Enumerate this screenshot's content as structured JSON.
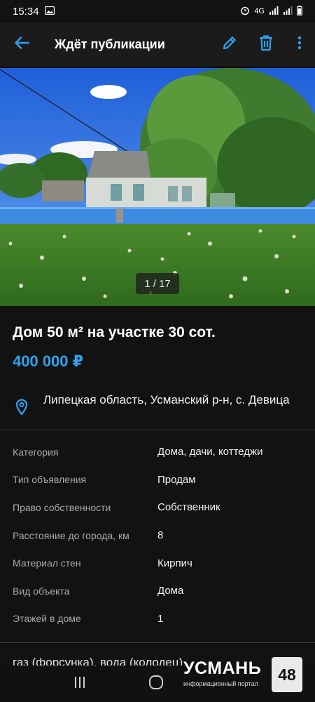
{
  "status_bar": {
    "time": "15:34",
    "network_label": "4G"
  },
  "app_bar": {
    "title": "Ждёт публикации"
  },
  "listing": {
    "photo_counter": "1 / 17",
    "title": "Дом 50 м² на участке 30 сот.",
    "price": "400 000 ₽",
    "location": "Липецкая область, Усманский р-н, с. Девица",
    "params": [
      {
        "key": "Категория",
        "value": "Дома, дачи, коттеджи"
      },
      {
        "key": "Тип объявления",
        "value": "Продам"
      },
      {
        "key": "Право собственности",
        "value": "Собственник"
      },
      {
        "key": "Расстояние до города, км",
        "value": "8"
      },
      {
        "key": "Материал стен",
        "value": "Кирпич"
      },
      {
        "key": "Вид объекта",
        "value": "Дома"
      },
      {
        "key": "Этажей в доме",
        "value": "1"
      }
    ],
    "description_peek": "газ (форсунка), вода (колодец)"
  },
  "watermark": {
    "name": "УСМАНЬ",
    "subtitle": "информационный портал",
    "badge": "48"
  },
  "colors": {
    "accent": "#2da3f1",
    "background": "#121212",
    "app_bar": "#1b1b1b"
  },
  "icons": {
    "back": "arrow-left-icon",
    "edit": "pencil-icon",
    "delete": "trash-icon",
    "more": "more-vertical-icon",
    "location": "location-pin-icon"
  }
}
